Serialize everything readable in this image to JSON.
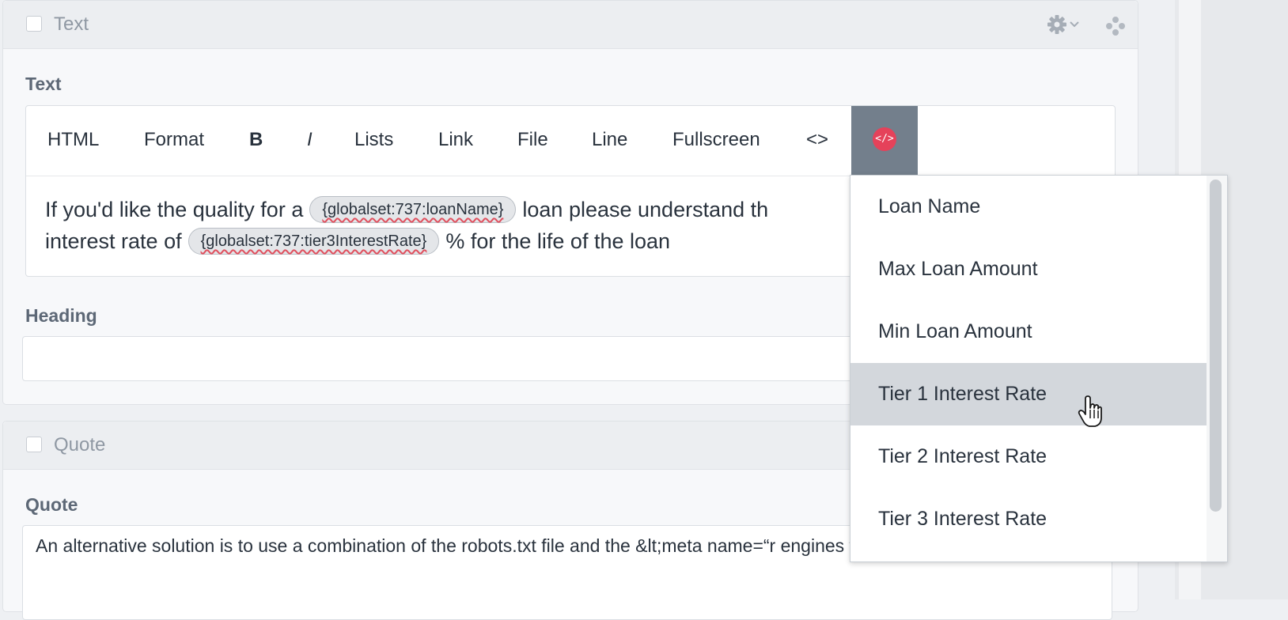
{
  "blocks": {
    "text": {
      "title": "Text",
      "field_label": "Text",
      "heading_label": "Heading",
      "heading_value": "",
      "toolbar": {
        "html": "HTML",
        "format": "Format",
        "bold": "B",
        "italic": "I",
        "lists": "Lists",
        "link": "Link",
        "file": "File",
        "line": "Line",
        "fullscreen": "Fullscreen",
        "code": "<>",
        "variables_badge": "</>"
      },
      "content": {
        "line1_a": "If you'd like the quality for a",
        "token1": "{globalset:737:loanName}",
        "line1_b": "loan please understand th",
        "line2_a": "interest rate of",
        "token2": "{globalset:737:tier3InterestRate}",
        "line2_b": "% for the life of the loan"
      }
    },
    "quote": {
      "title": "Quote",
      "field_label": "Quote",
      "textarea_value": "An alternative solution is to use a combination of the robots.txt file and the &lt;meta name=“r engines to ignore our staging website."
    }
  },
  "dropdown": {
    "items": [
      {
        "label": "Loan Name"
      },
      {
        "label": "Max Loan Amount"
      },
      {
        "label": "Min Loan Amount"
      },
      {
        "label": "Tier 1 Interest Rate"
      },
      {
        "label": "Tier 2 Interest Rate"
      },
      {
        "label": "Tier 3 Interest Rate"
      }
    ],
    "hovered": "Tier 1 Interest Rate"
  },
  "colors": {
    "accent_badge": "#e5425a",
    "active_toolbar": "#737f8c",
    "hover_item": "#d3d7dc"
  }
}
